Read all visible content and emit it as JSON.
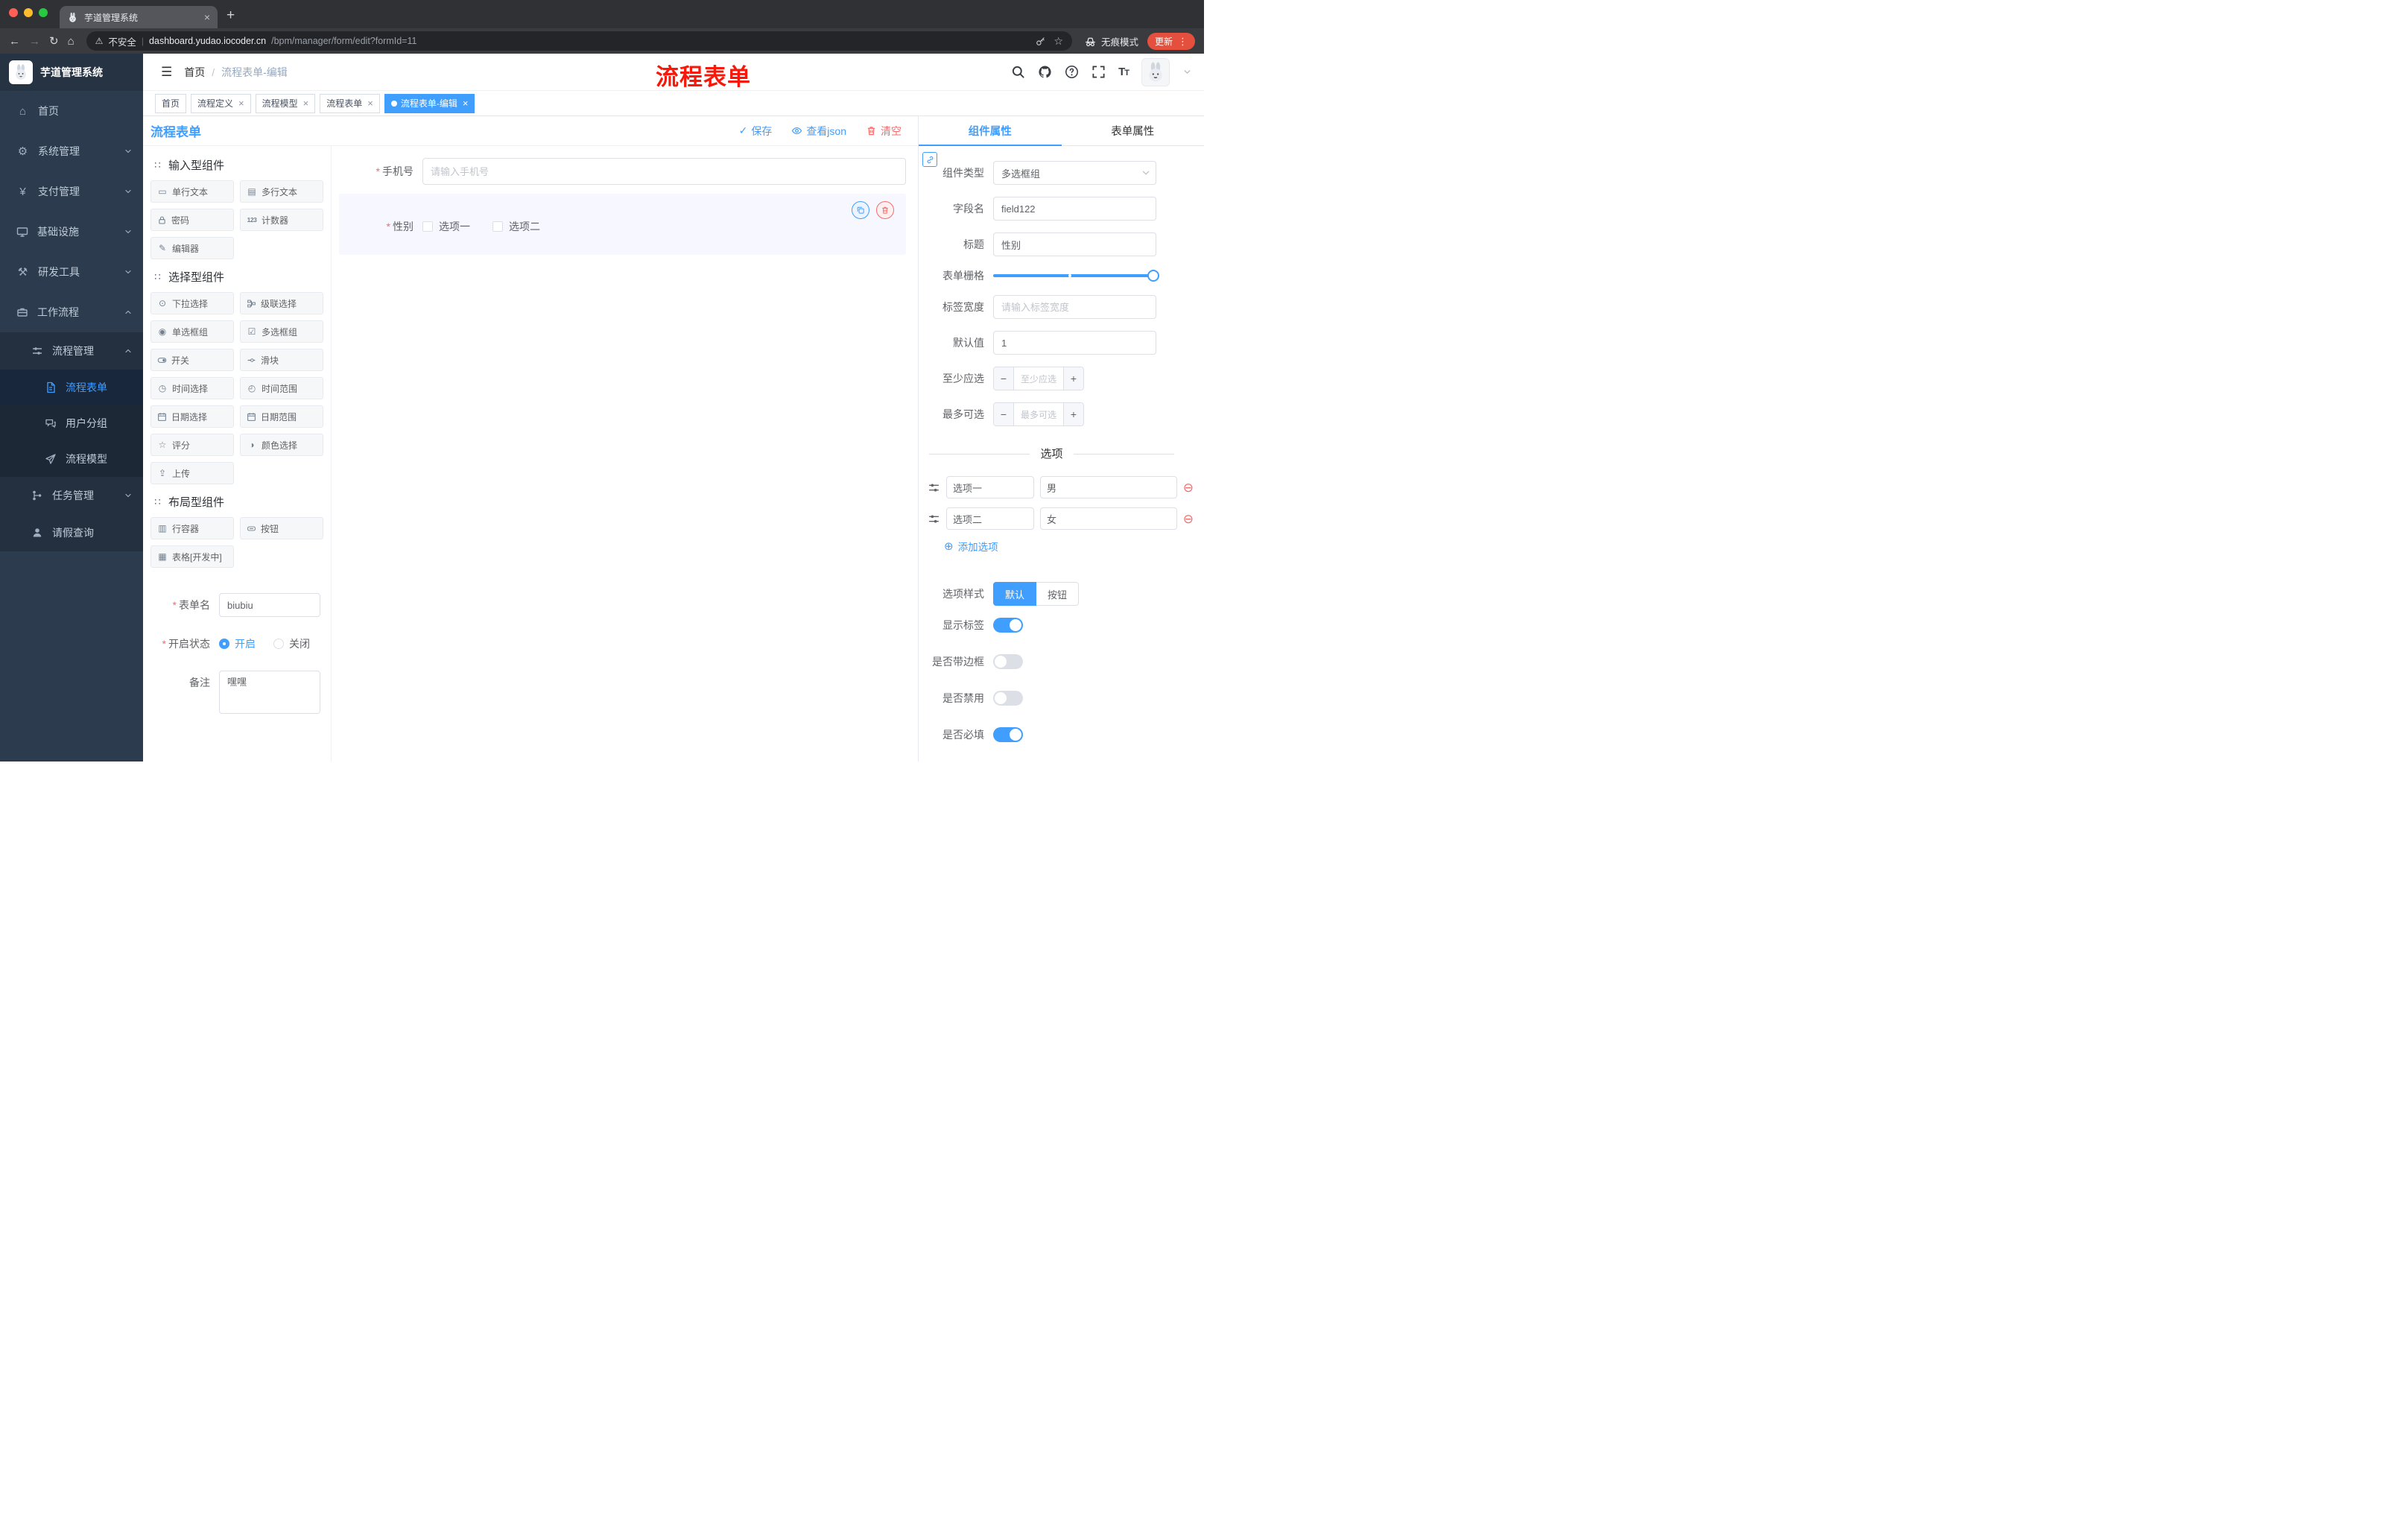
{
  "browser": {
    "tab_title": "芋道管理系统",
    "security_label": "不安全",
    "url_domain": "dashboard.yudao.iocoder.cn",
    "url_path": "/bpm/manager/form/edit?formId=11",
    "incognito_label": "无痕模式",
    "update_label": "更新"
  },
  "annotation": {
    "text": "流程表单"
  },
  "sidebar": {
    "logo_title": "芋道管理系统",
    "items": [
      {
        "label": "首页"
      },
      {
        "label": "系统管理"
      },
      {
        "label": "支付管理"
      },
      {
        "label": "基础设施"
      },
      {
        "label": "研发工具"
      },
      {
        "label": "工作流程"
      }
    ],
    "process_mgmt": {
      "label": "流程管理"
    },
    "process_children": [
      {
        "label": "流程表单",
        "active": true
      },
      {
        "label": "用户分组"
      },
      {
        "label": "流程模型"
      }
    ],
    "task_mgmt": {
      "label": "任务管理"
    },
    "leave_query": {
      "label": "请假查询"
    }
  },
  "header": {
    "breadcrumb_home": "首页",
    "breadcrumb_current": "流程表单-编辑"
  },
  "tags": [
    {
      "label": "首页"
    },
    {
      "label": "流程定义"
    },
    {
      "label": "流程模型"
    },
    {
      "label": "流程表单"
    },
    {
      "label": "流程表单-编辑"
    }
  ],
  "designer": {
    "title": "流程表单",
    "save": "保存",
    "view_json": "查看json",
    "clear": "清空",
    "groups": [
      {
        "title": "输入型组件",
        "items": [
          "单行文本",
          "多行文本",
          "密码",
          "计数器",
          "编辑器"
        ]
      },
      {
        "title": "选择型组件",
        "items": [
          "下拉选择",
          "级联选择",
          "单选框组",
          "多选框组",
          "开关",
          "滑块",
          "时间选择",
          "时间范围",
          "日期选择",
          "日期范围",
          "评分",
          "颜色选择",
          "上传"
        ]
      },
      {
        "title": "布局型组件",
        "items": [
          "行容器",
          "按钮",
          "表格[开发中]"
        ]
      }
    ],
    "meta": {
      "name_label": "表单名",
      "name_value": "biubiu",
      "status_label": "开启状态",
      "status_on": "开启",
      "status_off": "关闭",
      "remark_label": "备注",
      "remark_value": "嘿嘿"
    }
  },
  "canvas": {
    "phone": {
      "label": "手机号",
      "placeholder": "请输入手机号"
    },
    "gender": {
      "label": "性别",
      "options": [
        "选项一",
        "选项二"
      ]
    }
  },
  "props": {
    "tab_component": "组件属性",
    "tab_form": "表单属性",
    "rows": {
      "type_label": "组件类型",
      "type_value": "多选框组",
      "field_label": "字段名",
      "field_value": "field122",
      "title_label": "标题",
      "title_value": "性别",
      "grid_label": "表单栅格",
      "width_label": "标签宽度",
      "width_placeholder": "请输入标签宽度",
      "default_label": "默认值",
      "default_value": "1",
      "min_label": "至少应选",
      "min_placeholder": "至少应选",
      "max_label": "最多可选",
      "max_placeholder": "最多可选"
    },
    "options_title": "选项",
    "options": [
      {
        "name": "选项一",
        "value": "男"
      },
      {
        "name": "选项二",
        "value": "女"
      }
    ],
    "add_option": "添加选项",
    "style_label": "选项样式",
    "style_default": "默认",
    "style_button": "按钮",
    "switches": [
      {
        "label": "显示标签",
        "on": true
      },
      {
        "label": "是否带边框",
        "on": false
      },
      {
        "label": "是否禁用",
        "on": false
      },
      {
        "label": "是否必填",
        "on": true
      }
    ]
  },
  "colors": {
    "accent": "#409EFF",
    "danger": "#F56C6C",
    "update_button": "#E5503E",
    "annotation": "#F6190B"
  }
}
